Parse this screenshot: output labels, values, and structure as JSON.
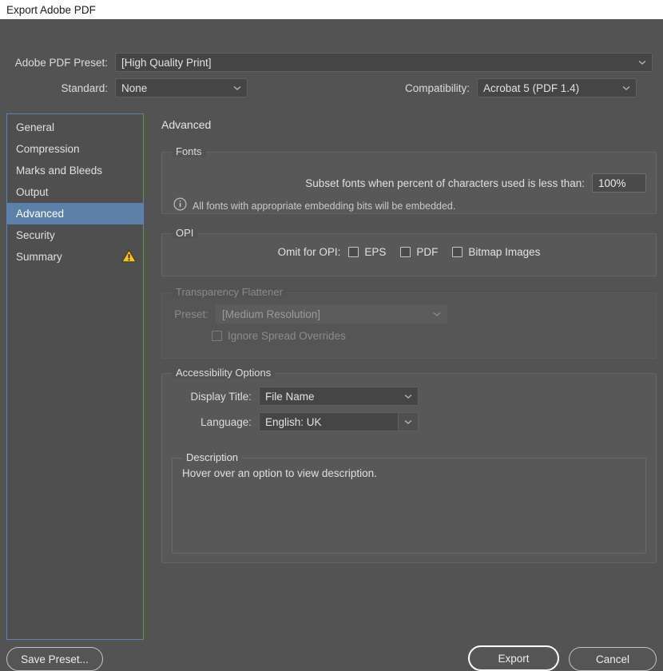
{
  "window": {
    "title": "Export Adobe PDF"
  },
  "top": {
    "preset_label": "Adobe PDF Preset:",
    "preset_value": "[High Quality Print]",
    "standard_label": "Standard:",
    "standard_value": "None",
    "compatibility_label": "Compatibility:",
    "compatibility_value": "Acrobat 5 (PDF 1.4)"
  },
  "sidebar": {
    "items": [
      {
        "label": "General",
        "selected": false,
        "badge": ""
      },
      {
        "label": "Compression",
        "selected": false,
        "badge": ""
      },
      {
        "label": "Marks and Bleeds",
        "selected": false,
        "badge": ""
      },
      {
        "label": "Output",
        "selected": false,
        "badge": ""
      },
      {
        "label": "Advanced",
        "selected": true,
        "badge": ""
      },
      {
        "label": "Security",
        "selected": false,
        "badge": ""
      },
      {
        "label": "Summary",
        "selected": false,
        "badge": "warning-icon"
      }
    ]
  },
  "panel": {
    "title": "Advanced",
    "fonts": {
      "legend": "Fonts",
      "subset_label": "Subset fonts when percent of characters used is less than:",
      "subset_value": "100%",
      "note": "All fonts with appropriate embedding bits will be embedded."
    },
    "opi": {
      "legend": "OPI",
      "omit_label": "Omit for OPI:",
      "options": [
        {
          "label": "EPS",
          "checked": false
        },
        {
          "label": "PDF",
          "checked": false
        },
        {
          "label": "Bitmap Images",
          "checked": false
        }
      ]
    },
    "flattener": {
      "legend": "Transparency Flattener",
      "preset_label": "Preset:",
      "preset_value": "[Medium Resolution]",
      "ignore_label": "Ignore Spread Overrides",
      "ignore_checked": false,
      "enabled": false
    },
    "accessibility": {
      "legend": "Accessibility Options",
      "display_title_label": "Display Title:",
      "display_title_value": "File Name",
      "language_label": "Language:",
      "language_value": "English: UK",
      "description": {
        "legend": "Description",
        "text": "Hover over an option to view description."
      }
    }
  },
  "buttons": {
    "save_preset": "Save Preset...",
    "export": "Export",
    "cancel": "Cancel"
  },
  "colors": {
    "dialog_bg": "#535353",
    "titlebar_bg": "#ffffff",
    "selection_blue": "#5d80a8",
    "focus_border": "#5b84b1",
    "warning_yellow": "#f0c419"
  }
}
